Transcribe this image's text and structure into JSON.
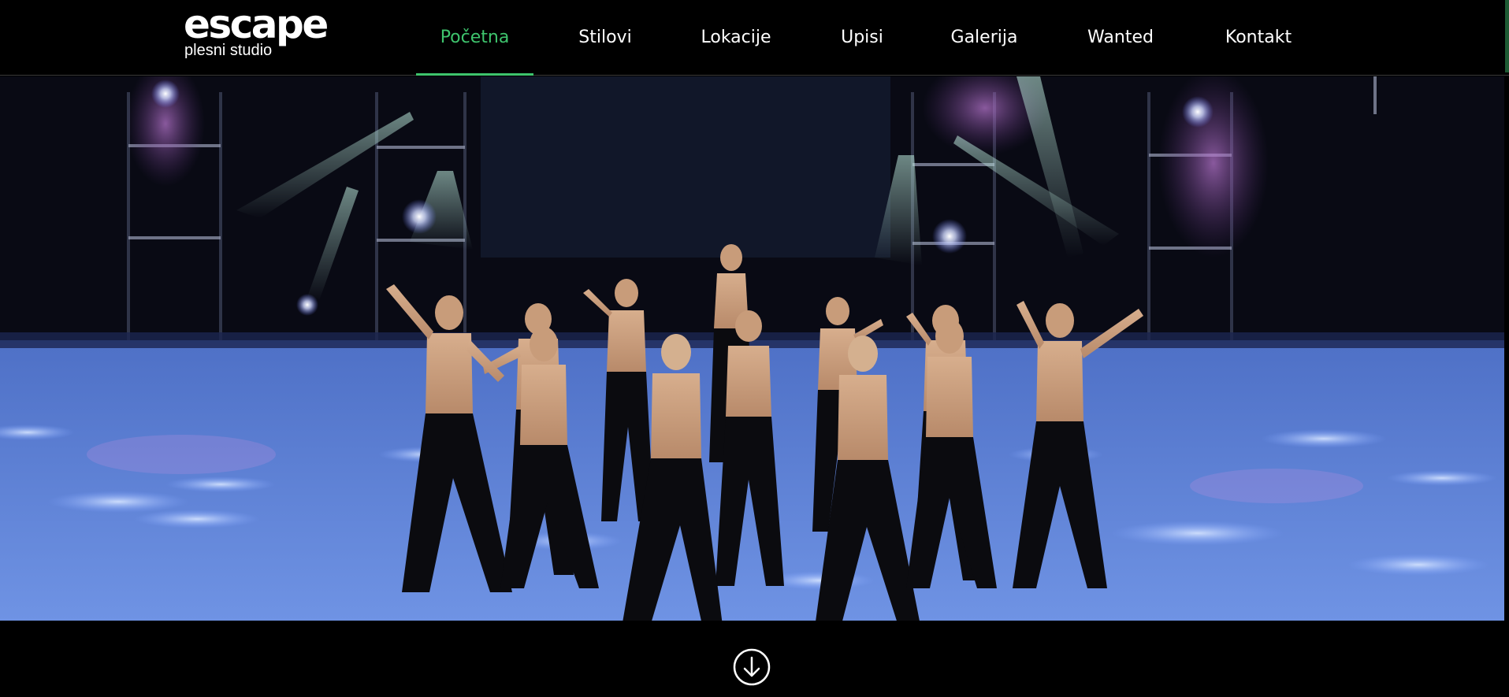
{
  "brand": {
    "name": "escape",
    "tagline": "plesni studio"
  },
  "nav": {
    "items": [
      {
        "label": "Početna",
        "active": true
      },
      {
        "label": "Stilovi",
        "active": false
      },
      {
        "label": "Lokacije",
        "active": false
      },
      {
        "label": "Upisi",
        "active": false
      },
      {
        "label": "Galerija",
        "active": false
      },
      {
        "label": "Wanted",
        "active": false
      },
      {
        "label": "Kontakt",
        "active": false
      }
    ]
  },
  "hero": {
    "image": "dance-group-on-stage-photo"
  },
  "icons": {
    "scroll_down": "arrow-down-circle-icon"
  },
  "colors": {
    "accent": "#3ec46d",
    "background": "#000000",
    "text": "#ffffff"
  }
}
